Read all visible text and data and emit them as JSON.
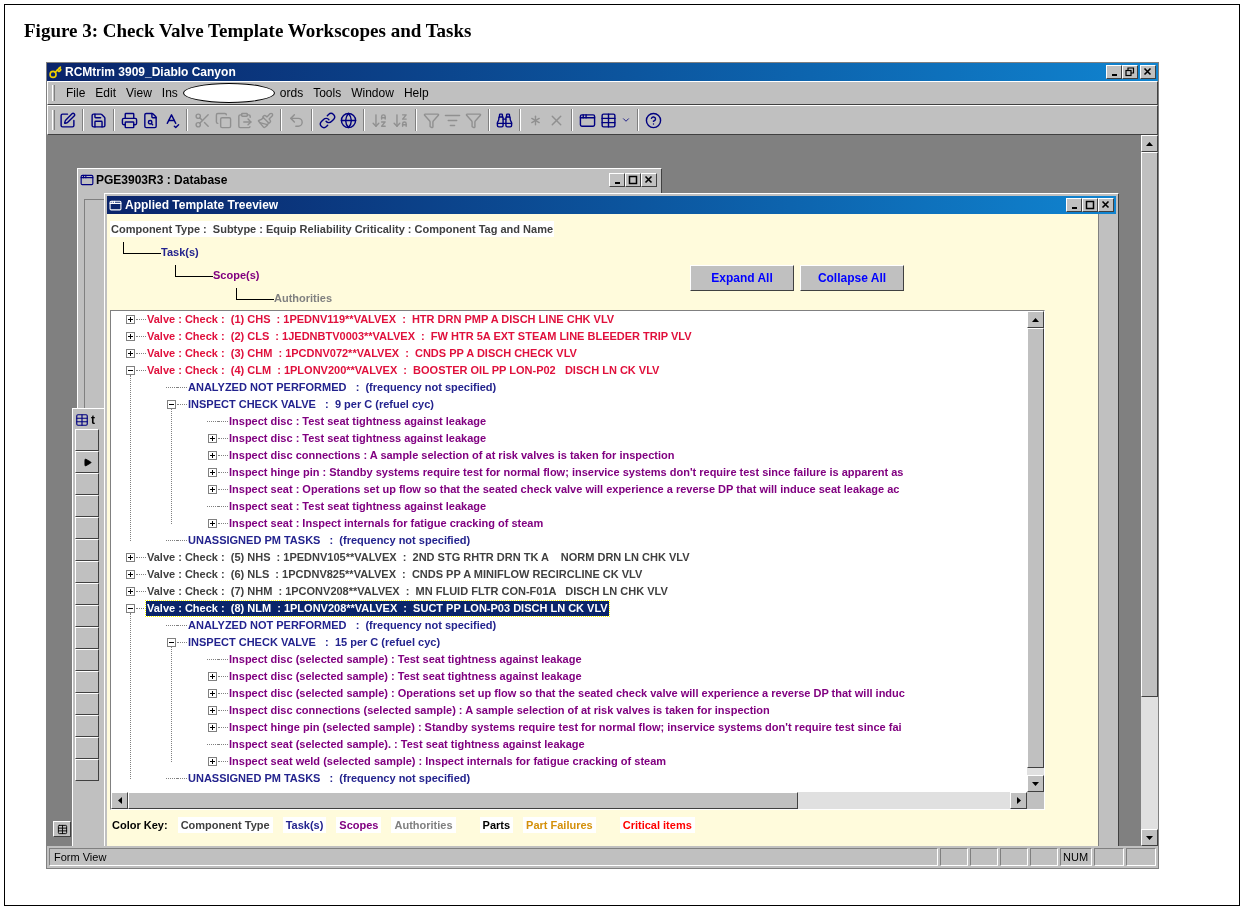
{
  "caption": "Figure 3: Check Valve Template Workscopes and Tasks",
  "app": {
    "title": "RCMtrim 3909_Diablo Canyon",
    "menu": [
      {
        "kind": "item",
        "label": "File"
      },
      {
        "kind": "item",
        "label": "Edit"
      },
      {
        "kind": "item",
        "label": "View"
      },
      {
        "kind": "item",
        "label": "Ins"
      },
      {
        "kind": "redaction"
      },
      {
        "kind": "item",
        "label": "ords"
      },
      {
        "kind": "item",
        "label": "Tools"
      },
      {
        "kind": "item",
        "label": "Window"
      },
      {
        "kind": "item",
        "label": "Help"
      }
    ]
  },
  "database_window": {
    "title": "PGE3903R3 : Database"
  },
  "form_window": {
    "title": "t"
  },
  "treeview": {
    "title": "Applied Template Treeview",
    "legend": [
      {
        "label": "Component Type :  Subtype : Equip Reliability Criticality : Component Tag and Name",
        "color": "#404040"
      },
      {
        "label": "Task(s)",
        "color": "#23238e"
      },
      {
        "label": "Scope(s)",
        "color": "#800080"
      },
      {
        "label": "Authorities",
        "color": "#808080"
      }
    ],
    "buttons": [
      "Expand All",
      "Collapse All"
    ],
    "tree": [
      {
        "kind": "component",
        "label": "Valve : Check :  (1) CHS  : 1PEDNV119**VALVEX  :  HTR DRN PMP A DISCH LINE CHK VLV",
        "critical": true,
        "selected": false,
        "expanded": false
      },
      {
        "kind": "component",
        "label": "Valve : Check :  (2) CLS  : 1JEDNBTV0003**VALVEX  :  FW HTR 5A EXT STEAM LINE BLEEDER TRIP VLV",
        "critical": true,
        "selected": false,
        "expanded": false
      },
      {
        "kind": "component",
        "label": "Valve : Check :  (3) CHM  : 1PCDNV072**VALVEX  :  CNDS PP A DISCH CHECK VLV",
        "critical": true,
        "selected": false,
        "expanded": false
      },
      {
        "kind": "component",
        "label": "Valve : Check :  (4) CLM  : 1PLONV200**VALVEX  :  BOOSTER OIL PP LON-P02   DISCH LN CK VLV",
        "critical": true,
        "selected": false,
        "expanded": true,
        "children": [
          {
            "kind": "task",
            "label": "ANALYZED NOT PERFORMED   :  (frequency not specified)"
          },
          {
            "kind": "task",
            "label": "INSPECT CHECK VALVE   :  9 per C (refuel cyc)",
            "expanded": true,
            "children": [
              {
                "kind": "scope",
                "label": "Inspect disc : Test seat tightness against leakage"
              },
              {
                "kind": "scope",
                "label": "Inspect disc : Test seat tightness against leakage",
                "expanded": false
              },
              {
                "kind": "scope",
                "label": "Inspect disc connections : A sample selection of at risk valves is taken for inspection",
                "expanded": false
              },
              {
                "kind": "scope",
                "label": "Inspect hinge pin : Standby systems require test for normal flow; inservice systems don't require test since failure is apparent as",
                "expanded": false
              },
              {
                "kind": "scope",
                "label": "Inspect seat : Operations set up flow so that the seated check valve will experience a reverse DP that will induce seat leakage ac",
                "expanded": false
              },
              {
                "kind": "scope",
                "label": "Inspect seat : Test seat tightness against leakage"
              },
              {
                "kind": "scope",
                "label": "Inspect seat : Inspect internals for fatigue cracking of steam",
                "expanded": false
              }
            ]
          },
          {
            "kind": "task",
            "label": "UNASSIGNED PM TASKS   :  (frequency not specified)"
          }
        ]
      },
      {
        "kind": "component",
        "label": "Valve : Check :  (5) NHS  : 1PEDNV105**VALVEX  :  2ND STG RHTR DRN TK A    NORM DRN LN CHK VLV",
        "critical": false,
        "selected": false,
        "expanded": false
      },
      {
        "kind": "component",
        "label": "Valve : Check :  (6) NLS  : 1PCDNV825**VALVEX  :  CNDS PP A MINIFLOW RECIRCLINE CK VLV",
        "critical": false,
        "selected": false,
        "expanded": false
      },
      {
        "kind": "component",
        "label": "Valve : Check :  (7) NHM  : 1PCONV208**VALVEX  :  MN FLUID FLTR CON-F01A   DISCH LN CHK VLV",
        "critical": false,
        "selected": false,
        "expanded": false
      },
      {
        "kind": "component",
        "label": "Valve : Check :  (8) NLM  : 1PLONV208**VALVEX  :  SUCT PP LON-P03 DISCH LN CK VLV",
        "critical": false,
        "selected": true,
        "expanded": true,
        "children": [
          {
            "kind": "task",
            "label": "ANALYZED NOT PERFORMED   :  (frequency not specified)"
          },
          {
            "kind": "task",
            "label": "INSPECT CHECK VALVE   :  15 per C (refuel cyc)",
            "expanded": true,
            "children": [
              {
                "kind": "scope",
                "label": "Inspect disc (selected sample) : Test seat tightness against leakage"
              },
              {
                "kind": "scope",
                "label": "Inspect disc (selected sample) : Test seat tightness against leakage",
                "expanded": false
              },
              {
                "kind": "scope",
                "label": "Inspect disc (selected sample) : Operations set up flow so that the seated check valve will experience a reverse DP that will induc",
                "expanded": false
              },
              {
                "kind": "scope",
                "label": "Inspect disc connections (selected sample) : A sample selection of at risk valves is taken for inspection",
                "expanded": false
              },
              {
                "kind": "scope",
                "label": "Inspect hinge pin (selected sample) : Standby systems require test for normal flow; inservice systems don't require test since fai",
                "expanded": false
              },
              {
                "kind": "scope",
                "label": "Inspect seat (selected sample). : Test seat tightness against leakage"
              },
              {
                "kind": "scope",
                "label": "Inspect seat weld (selected sample) : Inspect internals for fatigue cracking of steam",
                "expanded": false
              }
            ]
          },
          {
            "kind": "task",
            "label": "UNASSIGNED PM TASKS   :  (frequency not specified)"
          }
        ]
      }
    ],
    "color_key": {
      "label": "Color Key:",
      "items": [
        {
          "label": "Component Type",
          "color": "#404040"
        },
        {
          "label": "Task(s)",
          "color": "#23238e"
        },
        {
          "label": "Scopes",
          "color": "#800080"
        },
        {
          "label": "Authorities",
          "color": "#808080"
        },
        {
          "label": "Parts",
          "color": "#000000"
        },
        {
          "label": "Part Failures",
          "color": "#d4900a"
        },
        {
          "label": "Critical items",
          "color": "#ff0000"
        }
      ]
    }
  },
  "status_bar": {
    "text": "Form View",
    "indicators": [
      "NUM"
    ]
  }
}
